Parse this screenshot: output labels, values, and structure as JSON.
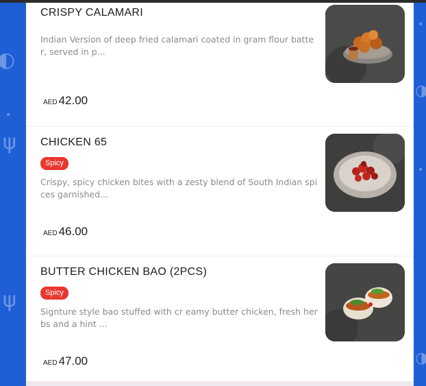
{
  "menu": {
    "items": [
      {
        "name": "CRISPY CALAMARI",
        "badge": "",
        "description": "Indian Version of deep fried calamari coated in gram flour batter, served in p...",
        "currency": "AED",
        "price": "42.00",
        "image_icon": "fried-calamari-bowl"
      },
      {
        "name": "CHICKEN 65",
        "badge": "Spicy",
        "description": "Crispy, spicy chicken bites with a zesty blend of South Indian spices garnished...",
        "currency": "AED",
        "price": "46.00",
        "image_icon": "chicken-65-plate"
      },
      {
        "name": "BUTTER CHICKEN BAO (2PCS)",
        "badge": "Spicy",
        "description": "Signture style bao stuffed with cr eamy butter chicken, fresh herbs and a hint ...",
        "currency": "AED",
        "price": "47.00",
        "image_icon": "bao-buns"
      }
    ]
  },
  "colors": {
    "background": "#1f5fd6",
    "badge": "#e8382f"
  }
}
